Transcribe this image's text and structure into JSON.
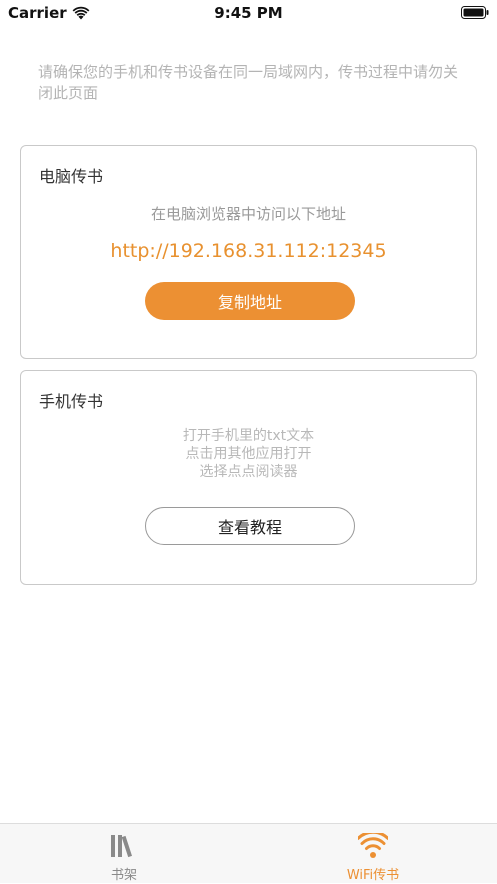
{
  "status_bar": {
    "carrier": "Carrier",
    "time": "9:45 PM",
    "wifi_icon": "wifi-icon",
    "battery_icon": "battery-icon"
  },
  "tip": "请确保您的手机和传书设备在同一局域网内，传书过程中请勿关闭此页面",
  "pc_card": {
    "title": "电脑传书",
    "hint": "在电脑浏览器中访问以下地址",
    "url": "http://192.168.31.112:12345",
    "copy_label": "复制地址"
  },
  "phone_card": {
    "title": "手机传书",
    "steps": [
      "打开手机里的txt文本",
      "点击用其他应用打开",
      "选择点点阅读器"
    ],
    "guide_label": "查看教程"
  },
  "tab_bar": {
    "items": [
      {
        "label": "书架",
        "icon": "bookshelf-icon",
        "selected": false
      },
      {
        "label": "WiFi传书",
        "icon": "wifi-icon",
        "selected": true
      }
    ]
  },
  "colors": {
    "accent": "#ec9033",
    "url_text": "#e8912f",
    "muted_text": "#b4b4b4",
    "card_border": "#c9c9c9"
  }
}
